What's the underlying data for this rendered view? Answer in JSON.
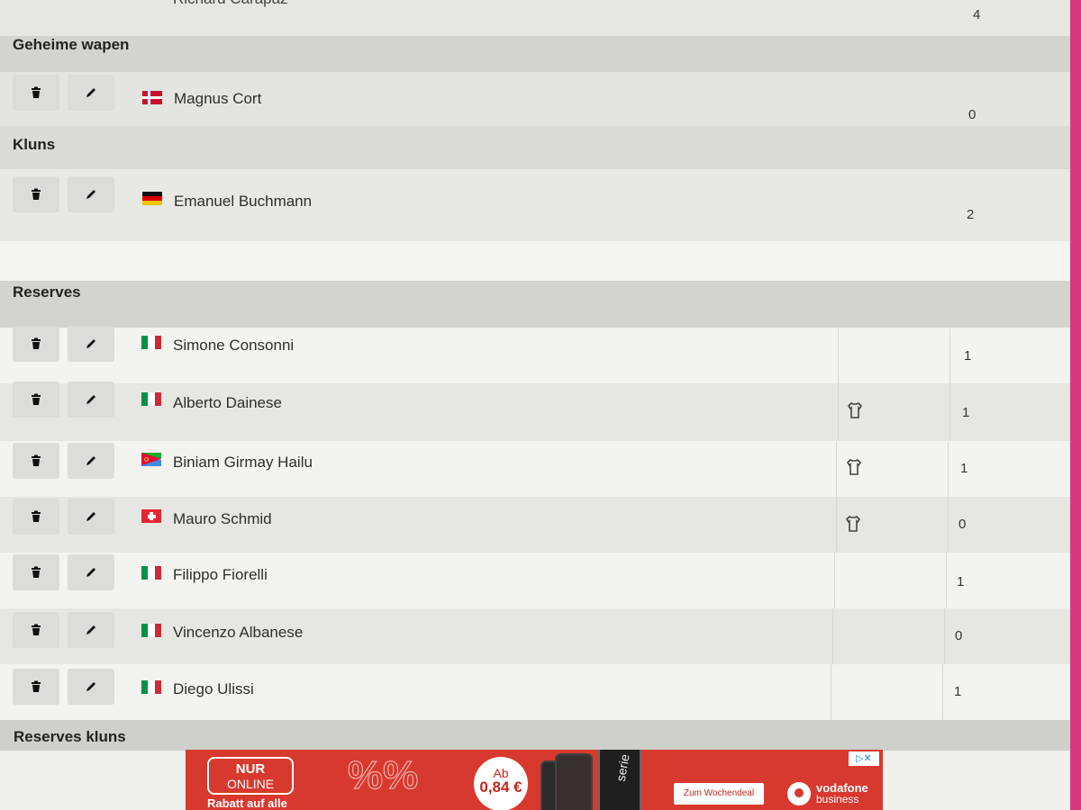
{
  "top_partial_row": {
    "name": "Richard Carapaz",
    "points": "4"
  },
  "sections": [
    {
      "title": "Geheime wapen",
      "riders": [
        {
          "name": "Magnus Cort",
          "country": "dk",
          "points": "0",
          "shirt": false
        }
      ]
    },
    {
      "title": "Kluns",
      "riders": [
        {
          "name": "Emanuel Buchmann",
          "country": "de",
          "points": "2",
          "shirt": false
        }
      ]
    },
    {
      "title": "Reserves",
      "riders": [
        {
          "name": "Simone Consonni",
          "country": "it",
          "points": "1",
          "shirt": false
        },
        {
          "name": "Alberto Dainese",
          "country": "it",
          "points": "1",
          "shirt": true
        },
        {
          "name": "Biniam Girmay Hailu",
          "country": "er",
          "points": "1",
          "shirt": true
        },
        {
          "name": "Mauro Schmid",
          "country": "ch",
          "points": "0",
          "shirt": true
        },
        {
          "name": "Filippo Fiorelli",
          "country": "it",
          "points": "1",
          "shirt": false
        },
        {
          "name": "Vincenzo Albanese",
          "country": "it",
          "points": "0",
          "shirt": false
        },
        {
          "name": "Diego Ulissi",
          "country": "it",
          "points": "1",
          "shirt": false
        }
      ]
    },
    {
      "title": "Reserves kluns",
      "riders": []
    }
  ],
  "icons": {
    "delete": "trash-icon",
    "edit": "pencil-icon",
    "shirt": "shirt-icon"
  },
  "colors": {
    "accent": "#d9387f",
    "section_bg": "#d3d3cf",
    "ad_red": "#d8392f"
  },
  "ad": {
    "nur": "NUR",
    "online": "ONLINE",
    "rabatt": "Rabatt auf alle",
    "price_prefix": "Ab",
    "price": "0,84 €",
    "phone_text": "serie",
    "cta": "Zum Wochendeal",
    "brand": "vodafone",
    "brand_sub": "business"
  }
}
